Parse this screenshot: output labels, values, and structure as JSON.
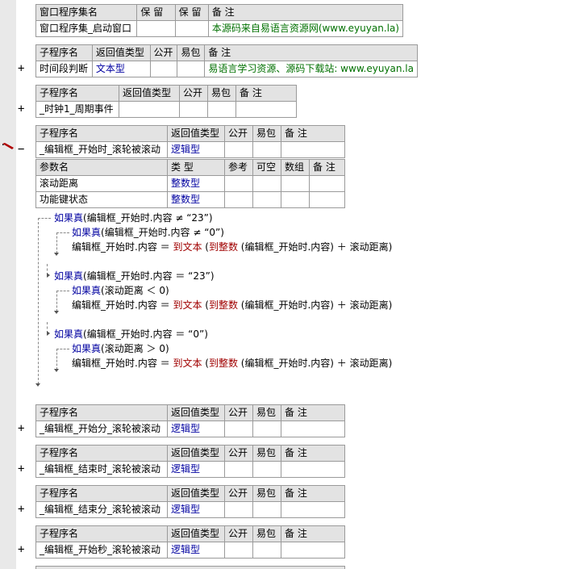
{
  "program_set": {
    "headers": [
      "窗口程序集名",
      "保 留",
      "保 留",
      "备 注"
    ],
    "name": "窗口程序集_启动窗口",
    "note": "本源码来自易语言资源网(www.eyuyan.la)"
  },
  "subs_header": [
    "子程序名",
    "返回值类型",
    "公开",
    "易包",
    "备 注"
  ],
  "sub_timeseg": {
    "name": "时间段判断",
    "type": "文本型",
    "note": "易语言学习资源、源码下载站: www.eyuyan.la"
  },
  "sub_clock": {
    "name": "_时钟1_周期事件"
  },
  "sub_main": {
    "name": "_编辑框_开始时_滚轮被滚动",
    "type": "逻辑型"
  },
  "params_header": [
    "参数名",
    "类 型",
    "参考",
    "可空",
    "数组",
    "备 注"
  ],
  "params": [
    {
      "name": "滚动距离",
      "type": "整数型"
    },
    {
      "name": "功能键状态",
      "type": "整数型"
    }
  ],
  "code": {
    "if1": {
      "kw": "如果真",
      "cond": "(编辑框_开始时.内容 ≠ “23”)"
    },
    "if1a": {
      "kw": "如果真",
      "cond": "(编辑框_开始时.内容 ≠ “0”)"
    },
    "stmt1_a": "编辑框_开始时.内容 ＝ ",
    "stmt_fn1": "到文本",
    "stmt_p1": " (",
    "stmt_fn2": "到整数",
    "stmt_rest": " (编辑框_开始时.内容) ＋ 滚动距离)",
    "if2": {
      "kw": "如果真",
      "cond": "(编辑框_开始时.内容 ＝ “23”)"
    },
    "if2a": {
      "kw": "如果真",
      "cond": "(滚动距离 ＜ 0)"
    },
    "if3": {
      "kw": "如果真",
      "cond": "(编辑框_开始时.内容 ＝ “0”)"
    },
    "if3a": {
      "kw": "如果真",
      "cond": "(滚动距离 ＞ 0)"
    }
  },
  "subs_bottom": [
    {
      "name": "_编辑框_开始分_滚轮被滚动",
      "type": "逻辑型"
    },
    {
      "name": "_编辑框_结束时_滚轮被滚动",
      "type": "逻辑型"
    },
    {
      "name": "_编辑框_结束分_滚轮被滚动",
      "type": "逻辑型"
    },
    {
      "name": "_编辑框_开始秒_滚轮被滚动",
      "type": "逻辑型"
    }
  ],
  "expander": {
    "plus": "+",
    "minus": "−"
  },
  "colors": {
    "keyword": "#0000a0",
    "function": "#a00000",
    "note": "#007000",
    "header": "#e3e3e3"
  }
}
